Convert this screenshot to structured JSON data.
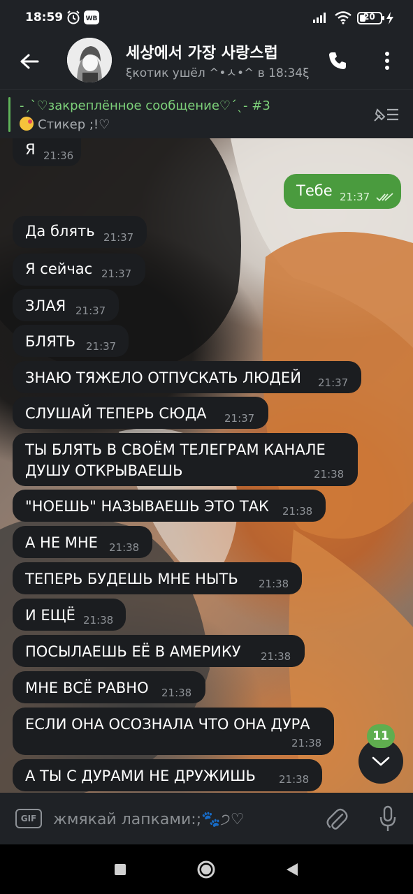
{
  "status_bar": {
    "time": "18:59",
    "battery": "20"
  },
  "header": {
    "title": "세상에서 가장 사랑스럽",
    "subtitle": "ξкотик ушёл ^•ㅅ•^ в 18:34ξ"
  },
  "pinned": {
    "title": "-ˏˋ♡закреплённое сообщение♡ˊˎ- #3",
    "text": "Стикер ;!♡"
  },
  "messages": [
    {
      "text": "Я",
      "time": "21:36",
      "direction": "in"
    },
    {
      "text": "Тебе",
      "time": "21:37",
      "direction": "out",
      "status": "read"
    },
    {
      "text": "Да блять",
      "time": "21:37",
      "direction": "in"
    },
    {
      "text": "Я сейчас",
      "time": "21:37",
      "direction": "in"
    },
    {
      "text": "ЗЛАЯ",
      "time": "21:37",
      "direction": "in"
    },
    {
      "text": "БЛЯТЬ",
      "time": "21:37",
      "direction": "in"
    },
    {
      "text": "ЗНАЮ ТЯЖЕЛО ОТПУСКАТЬ ЛЮДЕЙ",
      "time": "21:37",
      "direction": "in"
    },
    {
      "text": "СЛУШАЙ ТЕПЕРЬ СЮДА",
      "time": "21:37",
      "direction": "in"
    },
    {
      "text": "ТЫ БЛЯТЬ В СВОЁМ ТЕЛЕГРАМ КАНАЛЕ",
      "text_line2": "ДУШУ ОТКРЫВАЕШЬ",
      "time": "21:38",
      "direction": "in"
    },
    {
      "text": "\"НОЕШЬ\" НАЗЫВАЕШЬ ЭТО ТАК",
      "time": "21:38",
      "direction": "in"
    },
    {
      "text": "А НЕ МНЕ",
      "time": "21:38",
      "direction": "in"
    },
    {
      "text": "ТЕПЕРЬ БУДЕШЬ МНЕ НЫТЬ",
      "time": "21:38",
      "direction": "in"
    },
    {
      "text": "И ЕЩЁ",
      "time": "21:38",
      "direction": "in"
    },
    {
      "text": "ПОСЫЛАЕШЬ ЕЁ В АМЕРИКУ",
      "time": "21:38",
      "direction": "in"
    },
    {
      "text": "МНЕ ВСЁ РАВНО",
      "time": "21:38",
      "direction": "in"
    },
    {
      "text": "ЕСЛИ ОНА ОСОЗНАЛА ЧТО ОНА ДУРА",
      "time": "21:38",
      "direction": "in"
    },
    {
      "text": "А ТЫ С ДУРАМИ НЕ ДРУЖИШЬ",
      "time": "21:38",
      "direction": "in"
    }
  ],
  "scroll_down": {
    "unread_count": "11"
  },
  "input": {
    "gif_label": "GIF",
    "placeholder": "жмякай лапками:;🐾੭♡"
  },
  "colors": {
    "bar_bg": "#1f2226",
    "bubble_in": "#1b1d20",
    "bubble_out": "#4a9b3e",
    "accent_green": "#5fae4f",
    "pinned_green": "#7dd17a"
  },
  "icons": {
    "back": "arrow-left-icon",
    "call": "phone-icon",
    "menu": "more-vertical-icon",
    "pinned_list": "pinned-list-icon",
    "scroll_down": "chevron-down-icon",
    "attach": "paperclip-icon",
    "mic": "microphone-icon"
  }
}
